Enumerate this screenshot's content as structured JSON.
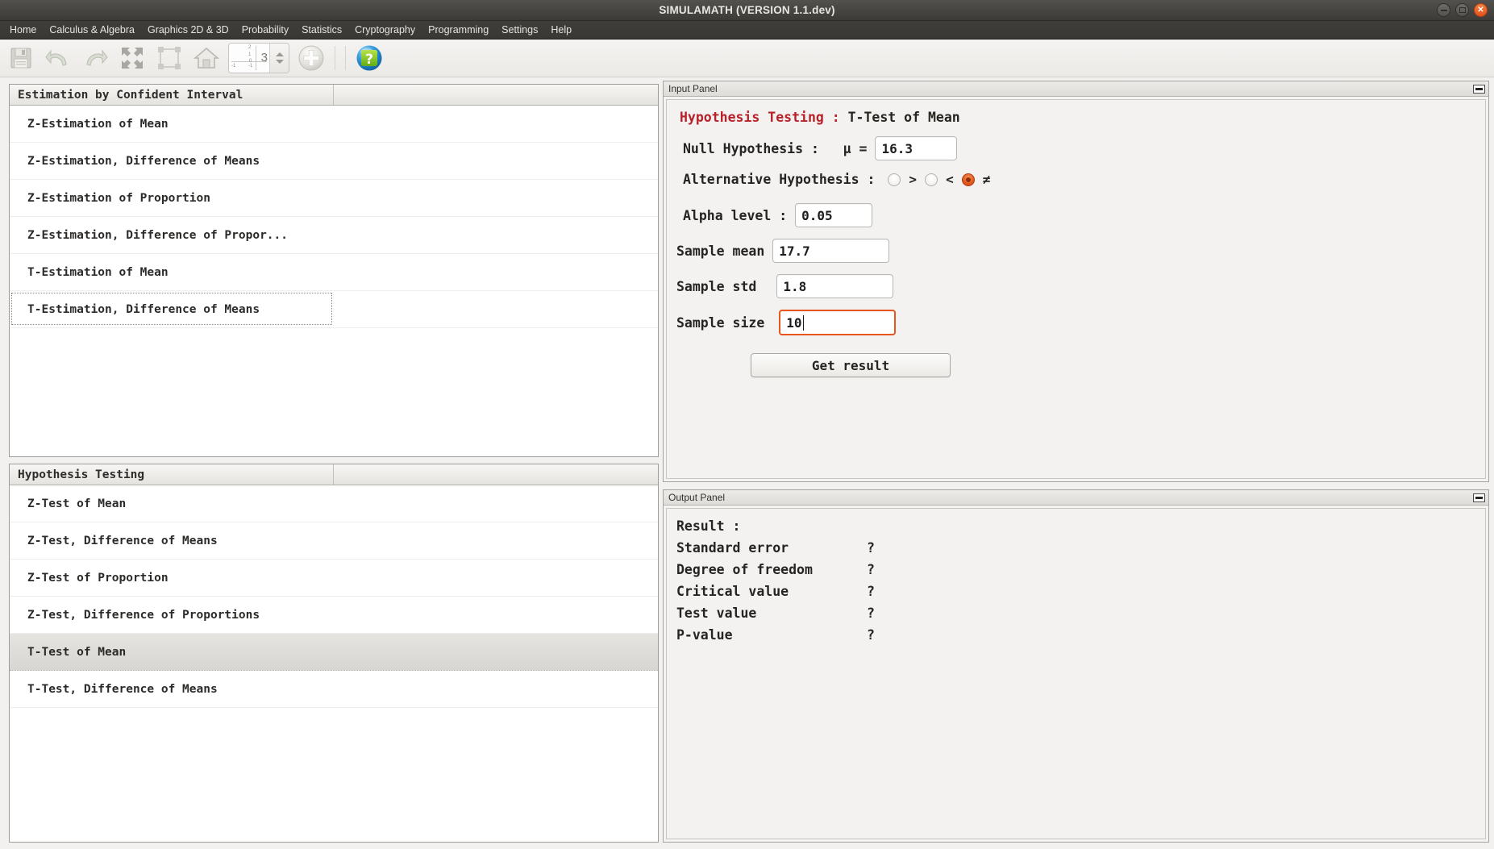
{
  "window": {
    "title": "SIMULAMATH   (VERSION 1.1.dev)",
    "controls": {
      "minimize": "minimize",
      "maximize": "maximize",
      "close": "close"
    }
  },
  "menubar": {
    "items": [
      {
        "label": "Home"
      },
      {
        "label": "Calculus & Algebra"
      },
      {
        "label": "Graphics 2D & 3D"
      },
      {
        "label": "Probability"
      },
      {
        "label": "Statistics"
      },
      {
        "label": "Cryptography"
      },
      {
        "label": "Programming"
      },
      {
        "label": "Settings"
      },
      {
        "label": "Help"
      }
    ]
  },
  "toolbar": {
    "buttons": [
      {
        "name": "save-icon"
      },
      {
        "name": "undo-icon"
      },
      {
        "name": "redo-icon"
      },
      {
        "name": "expand-icon"
      },
      {
        "name": "fit-frame-icon"
      },
      {
        "name": "home-icon"
      }
    ],
    "spinner": {
      "value": "3",
      "axis_labels": [
        "2",
        "1",
        "0",
        "-1",
        "-1"
      ]
    },
    "zoom_in_label": "+",
    "help_label": "?"
  },
  "left": {
    "estimation": {
      "header": "Estimation by Confident Interval",
      "items": [
        {
          "label": "Z-Estimation of Mean",
          "state": "normal"
        },
        {
          "label": "Z-Estimation, Difference of Means",
          "state": "normal"
        },
        {
          "label": "Z-Estimation of Proportion",
          "state": "normal"
        },
        {
          "label": "Z-Estimation, Difference of Propor...",
          "state": "normal"
        },
        {
          "label": "T-Estimation of Mean",
          "state": "normal"
        },
        {
          "label": "T-Estimation, Difference of Means",
          "state": "focused"
        }
      ]
    },
    "hypothesis": {
      "header": "Hypothesis Testing",
      "items": [
        {
          "label": "Z-Test of Mean",
          "state": "normal"
        },
        {
          "label": "Z-Test, Difference of Means",
          "state": "normal"
        },
        {
          "label": "Z-Test of Proportion",
          "state": "normal"
        },
        {
          "label": "Z-Test, Difference of Proportions",
          "state": "normal"
        },
        {
          "label": "T-Test of Mean",
          "state": "selected"
        },
        {
          "label": "T-Test, Difference of Means",
          "state": "normal"
        }
      ]
    }
  },
  "input_panel": {
    "dock_title": "Input Panel",
    "title_prefix": "Hypothesis Testing :",
    "title_suffix": " T-Test of Mean",
    "null_hypothesis_label": "Null Hypothesis :   μ =",
    "null_hypothesis_value": "16.3",
    "alternative_label": "Alternative Hypothesis :",
    "alternatives": [
      {
        "op": ">",
        "selected": false
      },
      {
        "op": "<",
        "selected": false
      },
      {
        "op": "≠",
        "selected": true
      }
    ],
    "alpha_label": "Alpha level :",
    "alpha_value": "0.05",
    "sample_mean_label": "Sample mean",
    "sample_mean_value": "17.7",
    "sample_std_label": "Sample std",
    "sample_std_value": "1.8",
    "sample_size_label": "Sample size",
    "sample_size_value": "10",
    "get_result_label": "Get result"
  },
  "output_panel": {
    "dock_title": "Output Panel",
    "result_label": "Result :",
    "rows": [
      {
        "key": "Standard error",
        "value": "?"
      },
      {
        "key": "Degree of freedom",
        "value": "?"
      },
      {
        "key": "Critical value",
        "value": "?"
      },
      {
        "key": "Test value",
        "value": "?"
      },
      {
        "key": "P-value",
        "value": "?"
      }
    ]
  },
  "colors": {
    "accent_red": "#b7212a",
    "focus_orange": "#e8551d",
    "titlebar": "#3c3b37",
    "close_button": "#e3531d"
  }
}
